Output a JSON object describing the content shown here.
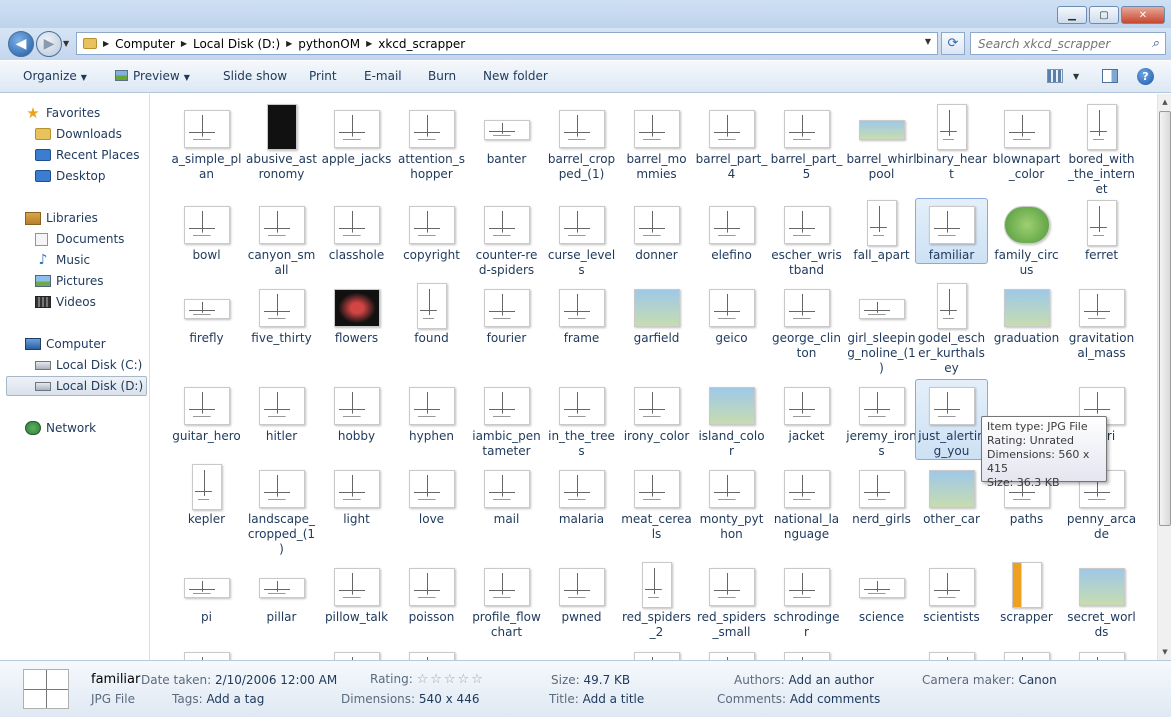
{
  "window": {
    "buttons": [
      "minimize",
      "maximize",
      "close"
    ]
  },
  "address": {
    "breadcrumbs": [
      "Computer",
      "Local Disk (D:)",
      "pythonOM",
      "xkcd_scrapper"
    ]
  },
  "search": {
    "placeholder": "Search xkcd_scrapper"
  },
  "toolbar": {
    "organize": "Organize",
    "preview": "Preview",
    "slideshow": "Slide show",
    "print": "Print",
    "email": "E-mail",
    "burn": "Burn",
    "new_folder": "New folder"
  },
  "nav": {
    "favorites": "Favorites",
    "downloads": "Downloads",
    "recent": "Recent Places",
    "desktop": "Desktop",
    "libraries": "Libraries",
    "documents": "Documents",
    "music": "Music",
    "pictures": "Pictures",
    "videos": "Videos",
    "computer": "Computer",
    "disk_c": "Local Disk (C:)",
    "disk_d": "Local Disk (D:)",
    "network": "Network"
  },
  "files": [
    "a_simple_plan",
    "abusive_astronomy",
    "apple_jacks",
    "attention_shopper",
    "banter",
    "barrel_cropped_(1)",
    "barrel_mommies",
    "barrel_part_4",
    "barrel_part_5",
    "barrel_whirlpool",
    "binary_heart",
    "blownapart_color",
    "bored_with_the_internet",
    "bowl",
    "canyon_small",
    "classhole",
    "copyright",
    "counter-red-spiders",
    "curse_levels",
    "donner",
    "elefino",
    "escher_wristband",
    "fall_apart",
    "familiar",
    "family_circus",
    "ferret",
    "firefly",
    "five_thirty",
    "flowers",
    "found",
    "fourier",
    "frame",
    "garfield",
    "geico",
    "george_clinton",
    "girl_sleeping_noline_(1)",
    "godel_escher_kurthalsey",
    "graduation",
    "gravitational_mass",
    "guitar_hero",
    "hitler",
    "hobby",
    "hyphen",
    "iambic_pentameter",
    "in_the_trees",
    "irony_color",
    "island_color",
    "jacket",
    "jeremy_irons",
    "just_alerting_you",
    "",
    "",
    "kepler",
    "landscape_cropped_(1)",
    "light",
    "love",
    "mail",
    "malaria",
    "meat_cereals",
    "monty_python",
    "national_language",
    "nerd_girls",
    "other_car",
    "paths",
    "penny_arcade",
    "pi",
    "pillar",
    "pillow_talk",
    "poisson",
    "profile_flowchart",
    "pwned",
    "red_spiders_2",
    "red_spiders_small",
    "schrodinger",
    "science",
    "scientists",
    "scrapper",
    "secret_worlds"
  ],
  "files_display": [
    [
      "a_simple_pl",
      "an"
    ],
    [
      "abusive_ast",
      "ronomy"
    ],
    [
      "apple_jacks"
    ],
    [
      "attention_s",
      "hopper"
    ],
    [
      "banter"
    ],
    [
      "barrel_crop",
      "ped_(1)"
    ],
    [
      "barrel_mo",
      "mmies"
    ],
    [
      "barrel_part_",
      "4"
    ],
    [
      "barrel_part_",
      "5"
    ],
    [
      "barrel_whirl",
      "pool"
    ],
    [
      "binary_hear",
      "t"
    ],
    [
      "blownapart",
      "_color"
    ],
    [
      "bored_with",
      "_the_intern",
      "et"
    ],
    [
      "bowl"
    ],
    [
      "canyon_sm",
      "all"
    ],
    [
      "classhole"
    ],
    [
      "copyright"
    ],
    [
      "counter-re",
      "d-spiders"
    ],
    [
      "curse_levels"
    ],
    [
      "donner"
    ],
    [
      "elefino"
    ],
    [
      "escher_wris",
      "tband"
    ],
    [
      "fall_apart"
    ],
    [
      "familiar"
    ],
    [
      "family_circ",
      "us"
    ],
    [
      "ferret"
    ],
    [
      "firefly"
    ],
    [
      "five_thirty"
    ],
    [
      "flowers"
    ],
    [
      "found"
    ],
    [
      "fourier"
    ],
    [
      "frame"
    ],
    [
      "garfield"
    ],
    [
      "geico"
    ],
    [
      "george_clin",
      "ton"
    ],
    [
      "girl_sleepin",
      "g_noline_(1",
      ")"
    ],
    [
      "godel_esch",
      "er_kurthals",
      "ey"
    ],
    [
      "graduation"
    ],
    [
      "gravitation",
      "al_mass"
    ],
    [
      "guitar_hero"
    ],
    [
      "hitler"
    ],
    [
      "hobby"
    ],
    [
      "hyphen"
    ],
    [
      "iambic_pen",
      "tameter"
    ],
    [
      "in_the_trees"
    ],
    [
      "irony_color"
    ],
    [
      "island_colo",
      "r"
    ],
    [
      "jacket"
    ],
    [
      "jeremy_iron",
      "s"
    ],
    [
      "just_alertin",
      "g_you"
    ],
    [
      ""
    ],
    [
      "mari"
    ],
    [
      "kepler"
    ],
    [
      "landscape_",
      "cropped_(1",
      ")"
    ],
    [
      "light"
    ],
    [
      "love"
    ],
    [
      "mail"
    ],
    [
      "malaria"
    ],
    [
      "meat_cerea",
      "ls"
    ],
    [
      "monty_pyt",
      "hon"
    ],
    [
      "national_la",
      "nguage"
    ],
    [
      "nerd_girls"
    ],
    [
      "other_car"
    ],
    [
      "paths"
    ],
    [
      "penny_arca",
      "de"
    ],
    [
      "pi"
    ],
    [
      "pillar"
    ],
    [
      "pillow_talk"
    ],
    [
      "poisson"
    ],
    [
      "profile_flow",
      "chart"
    ],
    [
      "pwned"
    ],
    [
      "red_spiders",
      "_2"
    ],
    [
      "red_spiders",
      "_small"
    ],
    [
      "schrodinge",
      "r"
    ],
    [
      "science"
    ],
    [
      "scientists"
    ],
    [
      "scrapper"
    ],
    [
      "secret_worl",
      "ds"
    ]
  ],
  "selected_file": "familiar",
  "hovered_file": "just_alerting_you",
  "tooltip": {
    "type": "Item type: JPG File",
    "rating": "Rating: Unrated",
    "dimensions": "Dimensions: 560 x 415",
    "size": "Size: 36.3 KB"
  },
  "details": {
    "name": "familiar",
    "type": "JPG File",
    "date_taken_label": "Date taken:",
    "date_taken": "2/10/2006 12:00 AM",
    "tags_label": "Tags:",
    "tags": "Add a tag",
    "rating_label": "Rating:",
    "rating_stars": "☆☆☆☆☆",
    "dimensions_label": "Dimensions:",
    "dimensions": "540 x 446",
    "size_label": "Size:",
    "size": "49.7 KB",
    "title_label": "Title:",
    "title": "Add a title",
    "authors_label": "Authors:",
    "authors": "Add an author",
    "comments_label": "Comments:",
    "comments": "Add comments",
    "camera_label": "Camera maker:",
    "camera": "Canon"
  }
}
